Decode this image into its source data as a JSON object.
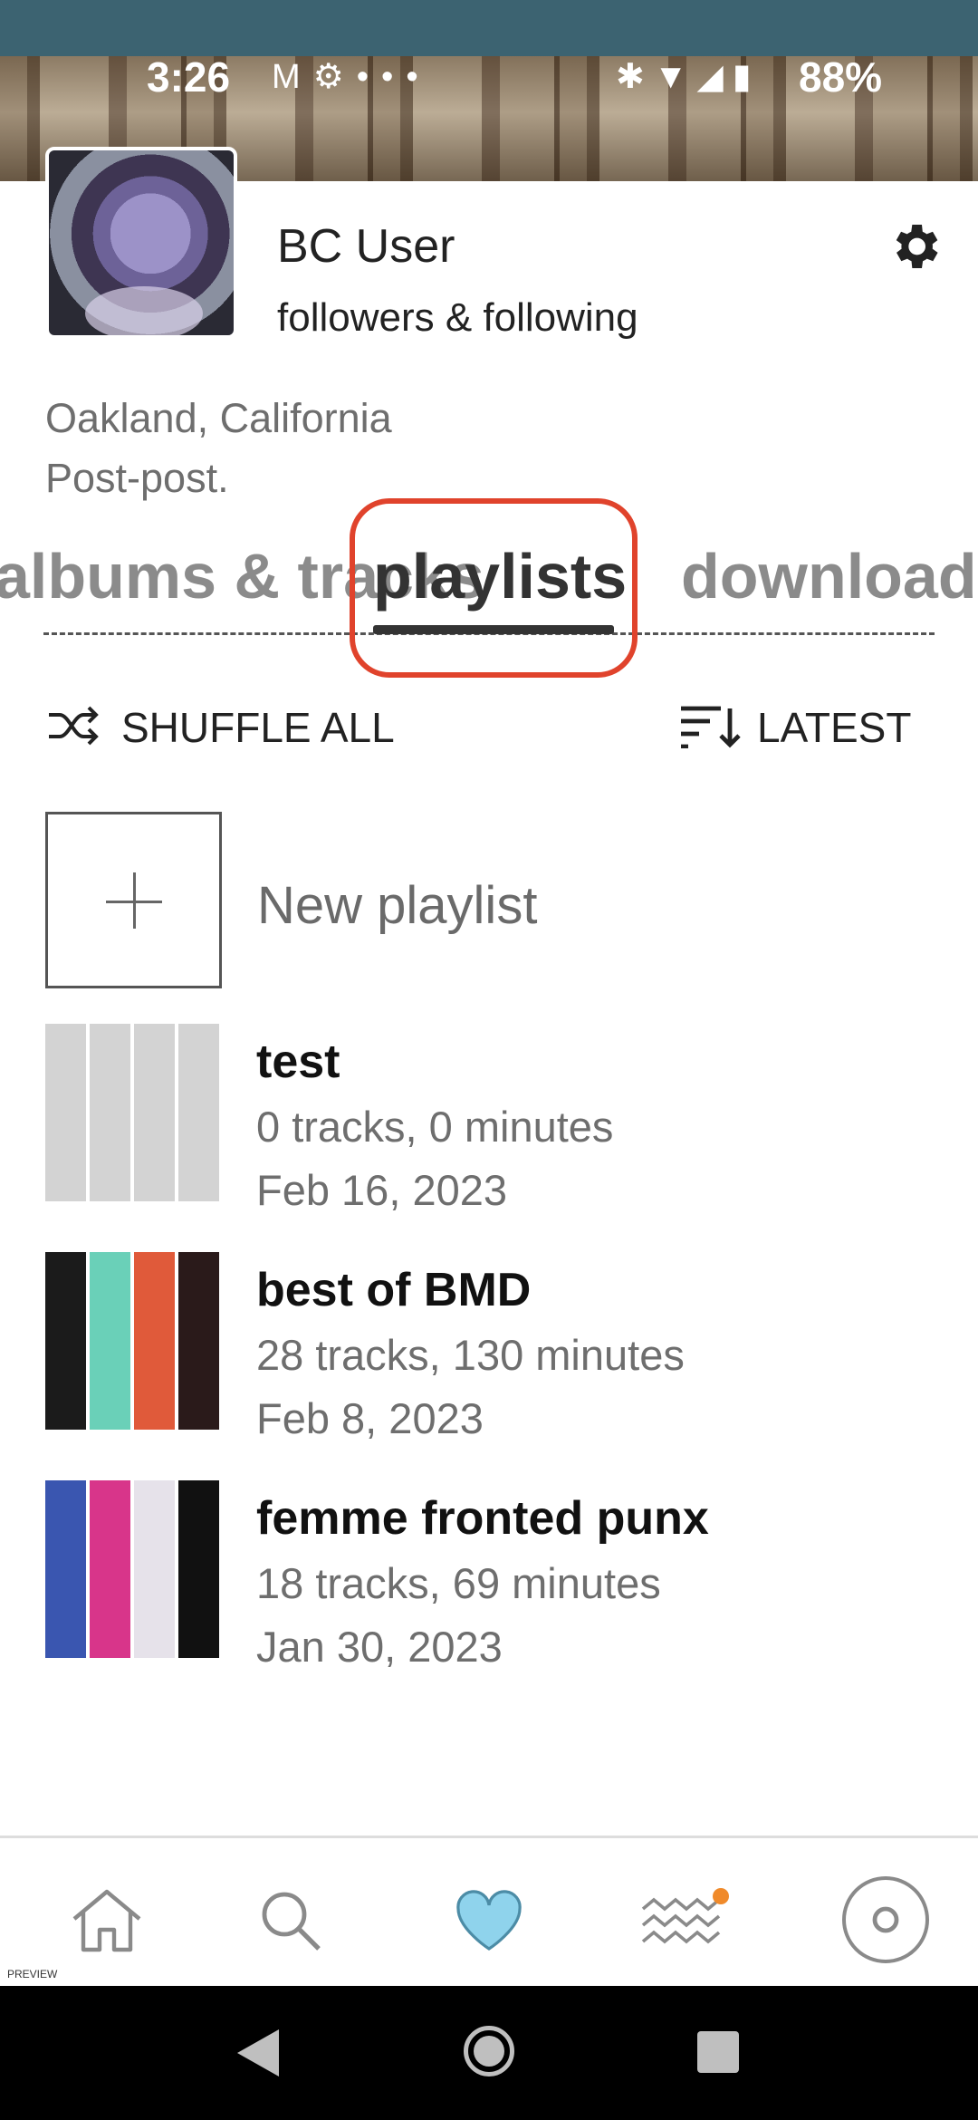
{
  "status_bar": {
    "time": "3:26",
    "left_icons": [
      "gmail-icon",
      "settings-gear-icon",
      "more-dots-icon"
    ],
    "right_icons": [
      "bluetooth-icon",
      "wifi-icon",
      "signal-icon",
      "battery-icon"
    ],
    "battery": "88%"
  },
  "profile": {
    "name": "BC User",
    "followers_link": "followers & following",
    "location": "Oakland, California",
    "bio": "Post-post."
  },
  "tabs": {
    "previous": "albums & tracks",
    "active": "playlists",
    "next": "downloads"
  },
  "actions": {
    "shuffle_label": "SHUFFLE ALL",
    "sort_label": "LATEST"
  },
  "new_playlist": {
    "label": "New playlist"
  },
  "playlists": [
    {
      "title": "test",
      "meta": "0 tracks, 0 minutes",
      "date": "Feb 16, 2023",
      "thumb_colors": [
        "#d3d3d3",
        "#d3d3d3",
        "#d3d3d3",
        "#d3d3d3"
      ]
    },
    {
      "title": "best of BMD",
      "meta": "28 tracks, 130 minutes",
      "date": "Feb 8, 2023",
      "thumb_colors": [
        "#1b1b1b",
        "#6ad0b8",
        "#e05a3a",
        "#2a1a1a"
      ]
    },
    {
      "title": "femme fronted punx",
      "meta": "18 tracks, 69 minutes",
      "date": "Jan 30, 2023",
      "thumb_colors": [
        "#3a56b0",
        "#d8358a",
        "#e6e2ea",
        "#111111"
      ]
    }
  ],
  "bottom_nav": {
    "items": [
      "home-icon",
      "search-icon",
      "heart-icon",
      "feed-waves-icon",
      "player-disc-icon"
    ],
    "active": "heart-icon",
    "notification_color": "#f08a2a",
    "preview_label": "PREVIEW"
  },
  "colors": {
    "accent_heart": "#8fd3ec",
    "tab_highlight": "#e0432c",
    "banner": "#3c6371"
  }
}
